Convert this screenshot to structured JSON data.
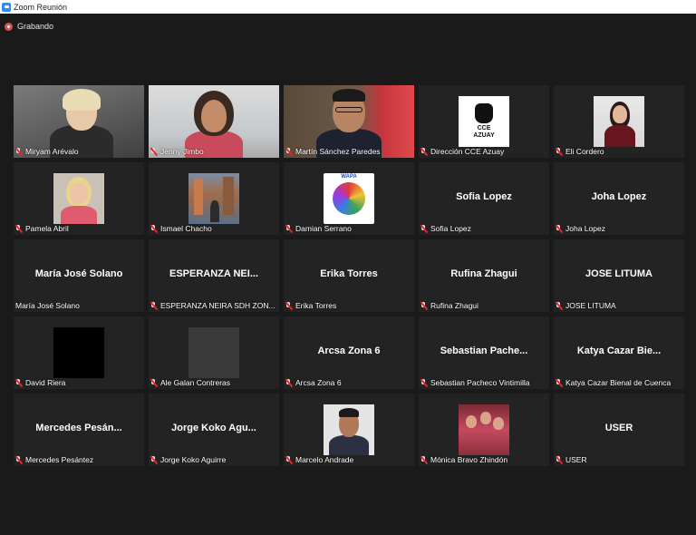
{
  "window": {
    "title": "Zoom Reunión"
  },
  "recording": {
    "label": "Grabando"
  },
  "colors": {
    "active_speaker": "#c7e23a",
    "mic_muted": "#e02828",
    "recording": "#d9534f"
  },
  "participants": [
    {
      "name": "Miryam Arévalo",
      "display": "",
      "type": "video"
    },
    {
      "name": "Jenny Jimbo",
      "display": "",
      "type": "video"
    },
    {
      "name": "Martín Sánchez Paredes",
      "display": "",
      "type": "video",
      "active": true
    },
    {
      "name": "Dirección CCE Azuay",
      "display": "",
      "type": "photo",
      "logo_text": "CCE AZUAY"
    },
    {
      "name": "Eli Cordero",
      "display": "",
      "type": "photo"
    },
    {
      "name": "Pamela Abril",
      "display": "",
      "type": "photo"
    },
    {
      "name": "Ismael Chacho",
      "display": "",
      "type": "photo"
    },
    {
      "name": "Damian Serrano",
      "display": "",
      "type": "photo",
      "logo_text": "WAPA"
    },
    {
      "name": "Sofia Lopez",
      "display": "Sofia Lopez",
      "type": "name"
    },
    {
      "name": "Joha Lopez",
      "display": "Joha Lopez",
      "type": "name"
    },
    {
      "name": "María José Solano",
      "display": "María José Solano",
      "type": "name",
      "unmuted": true
    },
    {
      "name": "ESPERANZA NEIRA SDH ZON...",
      "display": "ESPERANZA NEI...",
      "type": "name"
    },
    {
      "name": "Erika Torres",
      "display": "Erika Torres",
      "type": "name"
    },
    {
      "name": "Rufina Zhagui",
      "display": "Rufina Zhagui",
      "type": "name"
    },
    {
      "name": "JOSE LITUMA",
      "display": "JOSE LITUMA",
      "type": "name"
    },
    {
      "name": "David Riera",
      "display": "",
      "type": "photo"
    },
    {
      "name": "Ale Galan Contreras",
      "display": "",
      "type": "photo"
    },
    {
      "name": "Arcsa Zona 6",
      "display": "Arcsa Zona 6",
      "type": "name"
    },
    {
      "name": "Sebastian Pacheco Vintimilla",
      "display": "Sebastian Pache...",
      "type": "name"
    },
    {
      "name": "Katya Cazar Bienal de Cuenca",
      "display": "Katya Cazar Bie...",
      "type": "name"
    },
    {
      "name": "Mercedes Pesántez",
      "display": "Mercedes Pesán...",
      "type": "name"
    },
    {
      "name": "Jorge Koko Aguirre",
      "display": "Jorge Koko Agu...",
      "type": "name"
    },
    {
      "name": "Marcelo Andrade",
      "display": "",
      "type": "photo"
    },
    {
      "name": "Mónica Bravo Zhindón",
      "display": "",
      "type": "photo"
    },
    {
      "name": "USER",
      "display": "USER",
      "type": "name"
    }
  ]
}
